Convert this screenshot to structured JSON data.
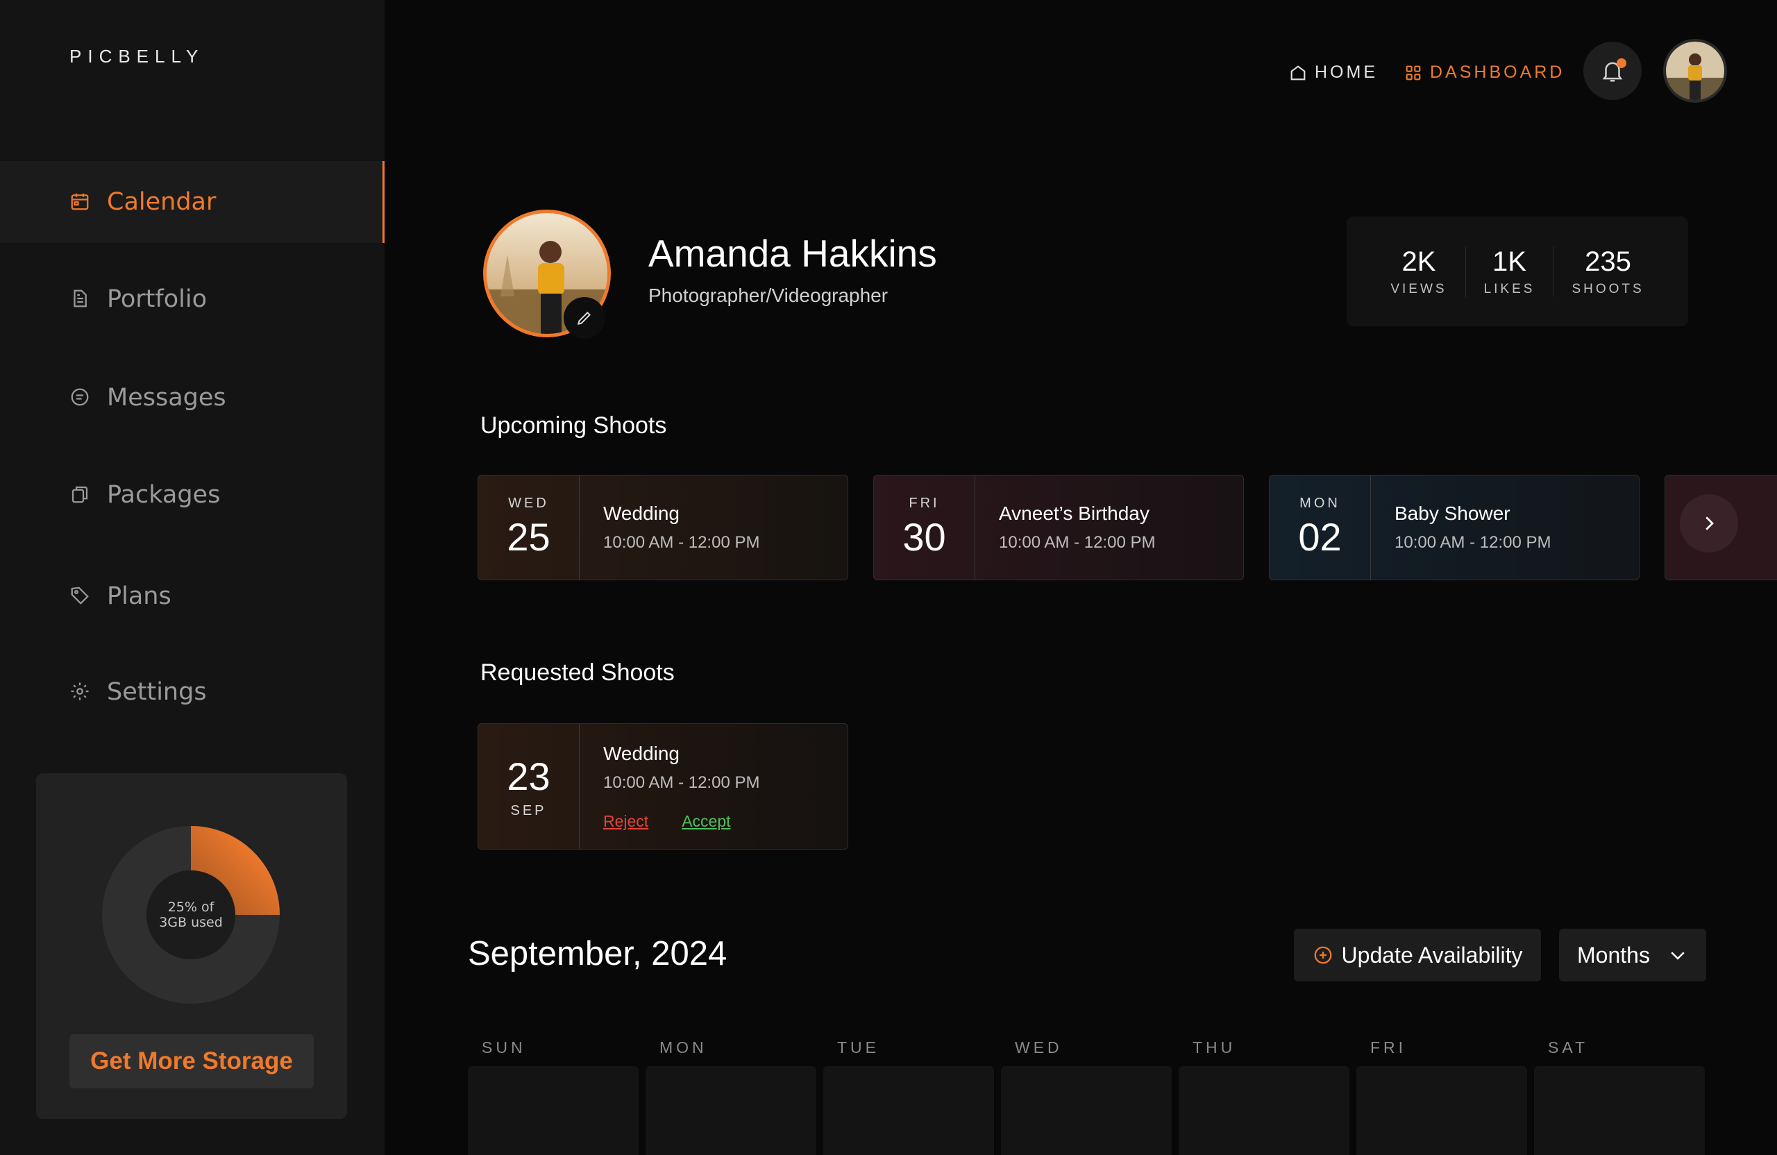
{
  "app": {
    "logo": "PICBELLY"
  },
  "sidebar": {
    "items": [
      {
        "label": "Calendar",
        "icon": "calendar-icon",
        "active": true
      },
      {
        "label": "Portfolio",
        "icon": "document-icon",
        "active": false
      },
      {
        "label": "Messages",
        "icon": "message-icon",
        "active": false
      },
      {
        "label": "Packages",
        "icon": "package-icon",
        "active": false
      },
      {
        "label": "Plans",
        "icon": "tag-icon",
        "active": false
      },
      {
        "label": "Settings",
        "icon": "gear-icon",
        "active": false
      }
    ],
    "storage": {
      "used_fraction": 0.25,
      "line1": "25% of",
      "line2": "3GB used",
      "button": "Get More Storage"
    }
  },
  "topbar": {
    "home": "HOME",
    "dashboard": "DASHBOARD",
    "accent": "#f07a2c"
  },
  "profile": {
    "name": "Amanda Hakkins",
    "role": "Photographer/Videographer",
    "stats": [
      {
        "value": "2K",
        "label": "VIEWS"
      },
      {
        "value": "1K",
        "label": "LIKES"
      },
      {
        "value": "235",
        "label": "SHOOTS"
      }
    ]
  },
  "upcoming": {
    "title": "Upcoming Shoots",
    "shoots": [
      {
        "dow": "WED",
        "day": "25",
        "title": "Wedding",
        "time": "10:00 AM - 12:00 PM",
        "color": "#2a1b13"
      },
      {
        "dow": "FRI",
        "day": "30",
        "title": "Avneet’s Birthday",
        "time": "10:00 AM - 12:00 PM",
        "color": "#2b161b"
      },
      {
        "dow": "MON",
        "day": "02",
        "title": "Baby Shower",
        "time": "10:00 AM - 12:00 PM",
        "color": "#13202a"
      }
    ]
  },
  "requested": {
    "title": "Requested Shoots",
    "shoots": [
      {
        "day": "23",
        "month": "SEP",
        "title": "Wedding",
        "time": "10:00 AM - 12:00 PM",
        "reject": "Reject",
        "accept": "Accept"
      }
    ]
  },
  "calendar": {
    "month_title": "September, 2024",
    "update_button": "Update Availability",
    "view_select": "Months",
    "days": [
      "SUN",
      "MON",
      "TUE",
      "WED",
      "THU",
      "FRI",
      "SAT"
    ]
  }
}
